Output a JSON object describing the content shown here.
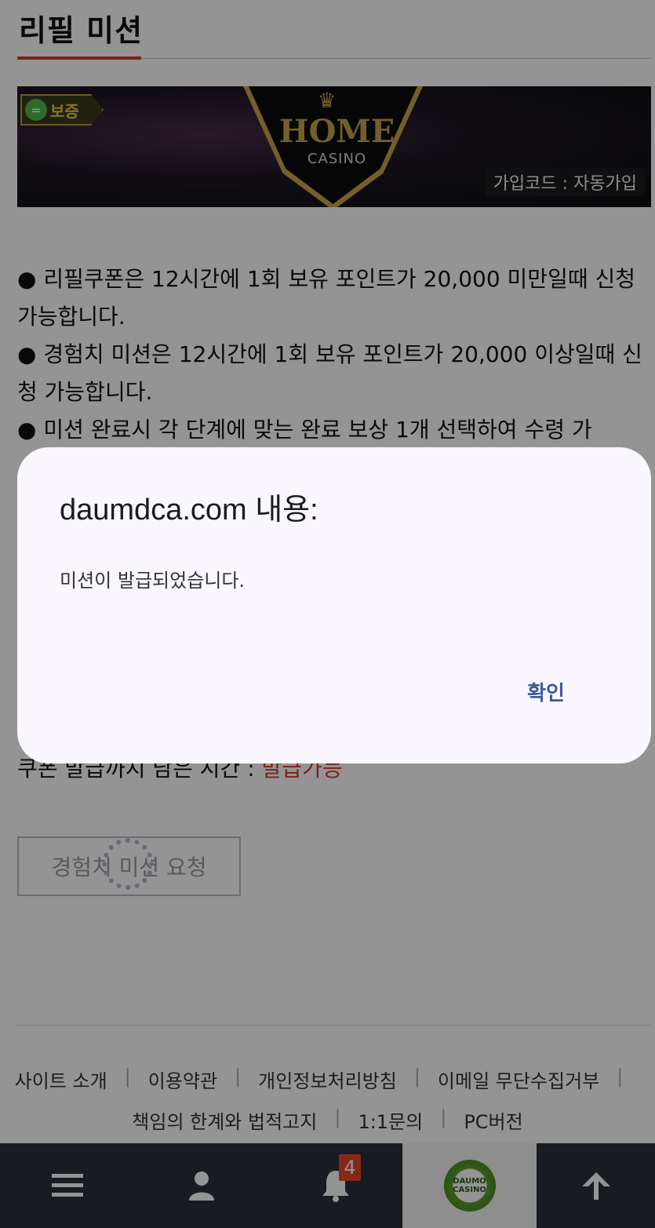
{
  "header": {
    "title": "리필 미션"
  },
  "banner": {
    "badge_text": "보증",
    "logo_home": "HOME",
    "logo_casino": "CASINO",
    "join_code": "가입코드 : 자동가입"
  },
  "info": {
    "lines": [
      "● 리필쿠폰은 12시간에 1회 보유 포인트가 20,000 미만일때 신청 가능합니다.",
      "● 경험치 미션은 12시간에 1회 보유 포인트가 20,000 이상일때 신청 가능합니다.",
      "● 미션 완료시 각 단계에 맞는 완료 보상 1개 선택하여 수령 가"
    ]
  },
  "remaining": {
    "label": "쿠폰 발급까지 남은 시간 :",
    "value": "발급가능"
  },
  "request_button": {
    "label": "경험치 미션 요청"
  },
  "footer": {
    "row1": [
      "사이트 소개",
      "이용약관",
      "개인정보처리방침",
      "이메일 무단수집거부"
    ],
    "row2": [
      "책임의 한계와 법적고지",
      "1:1문의",
      "PC버전"
    ]
  },
  "bottom_nav": {
    "notification_count": "4",
    "logo_text_1": "DAUMO",
    "logo_text_2": "CASINO"
  },
  "dialog": {
    "title": "daumdca.com 내용:",
    "message": "미션이 발급되었습니다.",
    "ok_label": "확인"
  },
  "colors": {
    "accent": "#d63b2d",
    "nav_bg": "#2a2f37",
    "dialog_bg": "#faf7ff",
    "dialog_button": "#3f5b98"
  },
  "icons": {
    "menu": "menu-icon",
    "user": "user-icon",
    "bell": "bell-icon",
    "logo": "daumo-casino-logo",
    "up": "arrow-up-icon"
  }
}
